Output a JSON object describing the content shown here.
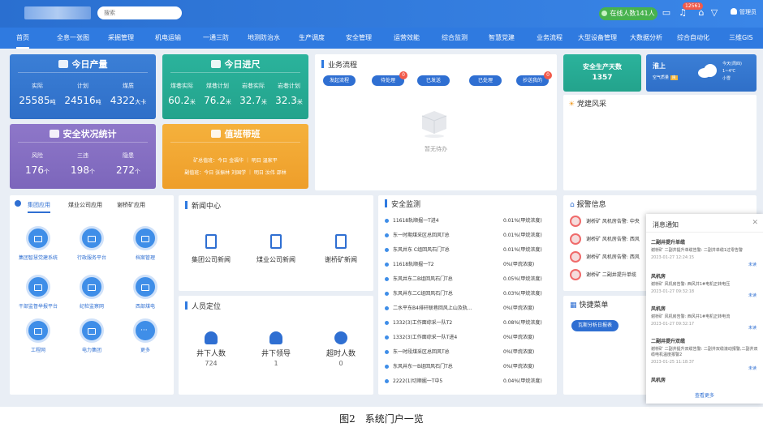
{
  "topbar": {
    "search_placeholder": "搜索",
    "online_label": "在线人数141人",
    "message_badge": "12561",
    "user_name": "管理员"
  },
  "nav": [
    "首页",
    "全息一张图",
    "采掘管理",
    "机电运输",
    "一通三防",
    "地测防治水",
    "生产调度",
    "安全管理",
    "运营效能",
    "综合监测",
    "智慧党建",
    "业务流程",
    "大型设备管理",
    "大数据分析",
    "综合自动化",
    "三维GIS"
  ],
  "production": {
    "title": "今日产量",
    "stats": [
      {
        "label": "实际",
        "value": "25585",
        "unit": "吨"
      },
      {
        "label": "计划",
        "value": "24516",
        "unit": "吨"
      },
      {
        "label": "煤质",
        "value": "4322",
        "unit": "大卡"
      }
    ]
  },
  "progress": {
    "title": "今日进尺",
    "stats": [
      {
        "label": "煤巷实际",
        "value": "60.2",
        "unit": "米"
      },
      {
        "label": "煤巷计划",
        "value": "76.2",
        "unit": "米"
      },
      {
        "label": "岩巷实际",
        "value": "32.7",
        "unit": "米"
      },
      {
        "label": "岩巷计划",
        "value": "32.3",
        "unit": "米"
      }
    ]
  },
  "safety_stats": {
    "title": "安全状况统计",
    "stats": [
      {
        "label": "风险",
        "value": "176",
        "unit": "个"
      },
      {
        "label": "三违",
        "value": "198",
        "unit": "个"
      },
      {
        "label": "隐患",
        "value": "272",
        "unit": "个"
      }
    ]
  },
  "duty": {
    "title": "值班带班",
    "line1": "矿总值班：今日 金福华 ｜ 明日 温家平",
    "line2": "副值班：今日 张振林 刘国学 ｜ 明日 汝伟 邵林"
  },
  "workflow": {
    "title": "业务流程",
    "buttons": [
      {
        "label": "发起流程",
        "badge": ""
      },
      {
        "label": "待处理",
        "badge": "0"
      },
      {
        "label": "已发送",
        "badge": ""
      },
      {
        "label": "已处理",
        "badge": ""
      },
      {
        "label": "抄送我的",
        "badge": "0"
      }
    ],
    "empty_text": "暂无待办"
  },
  "safety_days": {
    "label": "安全生产天数",
    "value": "1357"
  },
  "weather": {
    "city": "淮上",
    "aqi_label": "空气质量",
    "aqi": "良",
    "today": "今天(周四)",
    "temp": "1~4℃",
    "cond": "小雪"
  },
  "party": {
    "title": "党建风采"
  },
  "apps": {
    "tabs": [
      "集团应用",
      "煤业公司应用",
      "谢桥矿应用"
    ],
    "items": [
      "集团智慧党建系统",
      "行政服务平台",
      "档案管理",
      "干部监督举报平台",
      "纪检监察网",
      "西部煤电",
      "工程网",
      "电力集团",
      "更多"
    ]
  },
  "news": {
    "title": "新闻中心",
    "items": [
      "集团公司新闻",
      "煤业公司新闻",
      "谢桥矿新闻"
    ]
  },
  "personnel": {
    "title": "人员定位",
    "items": [
      {
        "label": "井下人数",
        "value": "724"
      },
      {
        "label": "井下领导",
        "value": "1"
      },
      {
        "label": "超时人数",
        "value": "0"
      }
    ]
  },
  "monitor": {
    "title": "安全监测",
    "rows": [
      {
        "name": "11618轨顺掘一T进4",
        "value": "0.01%(甲烷浓度)"
      },
      {
        "name": "东一时期煤采区总回风T总",
        "value": "0.01%(甲烷浓度)"
      },
      {
        "name": "东风井东    C组回风石门T总",
        "value": "0.01%(甲烷浓度)"
      },
      {
        "name": "11618轨顺掘一T2",
        "value": "0%(甲烷浓度)"
      },
      {
        "name": "东风井东二B组回风石门T总",
        "value": "0.05%(甲烷浓度)"
      },
      {
        "name": "东风井东二C组回风石门T总",
        "value": "0.03%(甲烷浓度)"
      },
      {
        "name": "二水平东B4排矸联巷回风上山及轨...",
        "value": "0%(甲烷浓度)"
      },
      {
        "name": "1332(3)工作面综采一队T2",
        "value": "0.08%(甲烷浓度)"
      },
      {
        "name": "1332(3)工作面综采一队T进4",
        "value": "0%(甲烷浓度)"
      },
      {
        "name": "东一时段煤采区总回风T总",
        "value": "0%(甲烷浓度)"
      },
      {
        "name": "东风井东一B组回风石门T总",
        "value": "0%(甲烷浓度)"
      },
      {
        "name": "2222(1)切顺掘一T中5",
        "value": "0.04%(甲烷浓度)"
      }
    ]
  },
  "alarms": {
    "title": "报警信息",
    "items": [
      "谢桥矿 风机房告警: 中央",
      "谢桥矿 风机房告警: 西风",
      "谢桥矿 风机房告警: 西风",
      "谢桥矿 二副井提升单缆"
    ]
  },
  "quick": {
    "title": "快捷菜单",
    "button": "瓦斯分析日报表"
  },
  "notifications": {
    "title": "消息通知",
    "items": [
      {
        "title": "二副井提升单缆",
        "desc": "谢桥矿 二副井提升单缆告警: 二副井单缆1过零告警",
        "time": "2023-01-27 12:24:15"
      },
      {
        "title": "风机房",
        "desc": "谢桥矿 风机房告警: 西风井1#电机正转电压",
        "time": "2023-01-27 09:32:18"
      },
      {
        "title": "风机房",
        "desc": "谢桥矿 风机房告警: 西风井1#电机正转电流",
        "time": "2023-01-27 09:32:17"
      },
      {
        "title": "二副井提升双缆",
        "desc": "谢桥矿 二副井提升双缆告警: 二副井双缆滚动报警,二副井双缆电机温度报警2",
        "time": "2023-01-25 11:18:37"
      },
      {
        "title": "风机房",
        "desc": "",
        "time": ""
      }
    ],
    "more_label": "未读",
    "view_all": "查看更多"
  },
  "caption": "图2　系统门户一览"
}
